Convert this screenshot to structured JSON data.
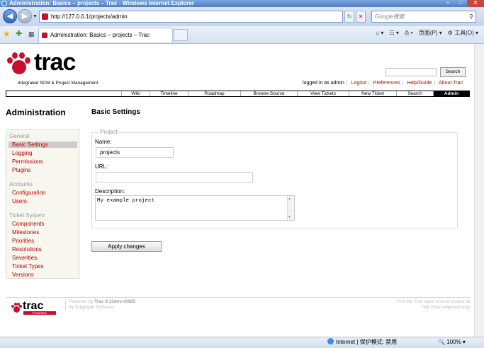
{
  "browser": {
    "window_title": "Administration: Basics – projects – Trac - Windows Internet Explorer",
    "url": "http://127.0.0.1/projects/admin",
    "search_placeholder": "Google搜索",
    "tab_title": "Administration: Basics – projects – Trac",
    "page_menu": "页面(P)",
    "tools_menu": "工具(O)",
    "status_zone": "Internet | 保护模式: 禁用",
    "zoom": "100%"
  },
  "trac": {
    "logo_word": "trac",
    "logo_tagline": "Integrated SCM & Project Management",
    "search_button": "Search",
    "metanav": {
      "logged_in": "logged in as admin",
      "logout": "Logout",
      "preferences": "Preferences",
      "help": "Help/Guide",
      "about": "About Trac"
    },
    "mainnav": [
      "Wiki",
      "Timeline",
      "Roadmap",
      "Browse Source",
      "View Tickets",
      "New Ticket",
      "Search",
      "Admin"
    ],
    "sidebar_title": "Administration",
    "content_title": "Basic Settings",
    "sidebar": {
      "general": "General",
      "basic_settings": "Basic Settings",
      "logging": "Logging",
      "permissions": "Permissions",
      "plugins": "Plugins",
      "accounts": "Accounts",
      "configuration": "Configuration",
      "users": "Users",
      "ticket_system": "Ticket System",
      "components": "Components",
      "milestones": "Milestones",
      "priorities": "Priorities",
      "resolutions": "Resolutions",
      "severities": "Severities",
      "ticket_types": "Ticket Types",
      "versions": "Versions"
    },
    "form": {
      "legend": "Project",
      "name_label": "Name:",
      "name_value": "projects",
      "url_label": "URL:",
      "url_value": "",
      "description_label": "Description:",
      "description_value": "My example project",
      "apply_button": "Apply changes"
    },
    "footer": {
      "logo_word": "trac",
      "logo_powered": "POWERED",
      "powered_by": "Powered by",
      "version": "Trac 0.11dev-r6425",
      "by_line": "By Edgewall Software.",
      "visit_line1": "Visit the Trac open source project at",
      "visit_line2": "http://trac.edgewall.org/"
    }
  },
  "colors": {
    "link_red": "#bb0000",
    "paw_red": "#c8102e",
    "active_nav": "#000000"
  }
}
